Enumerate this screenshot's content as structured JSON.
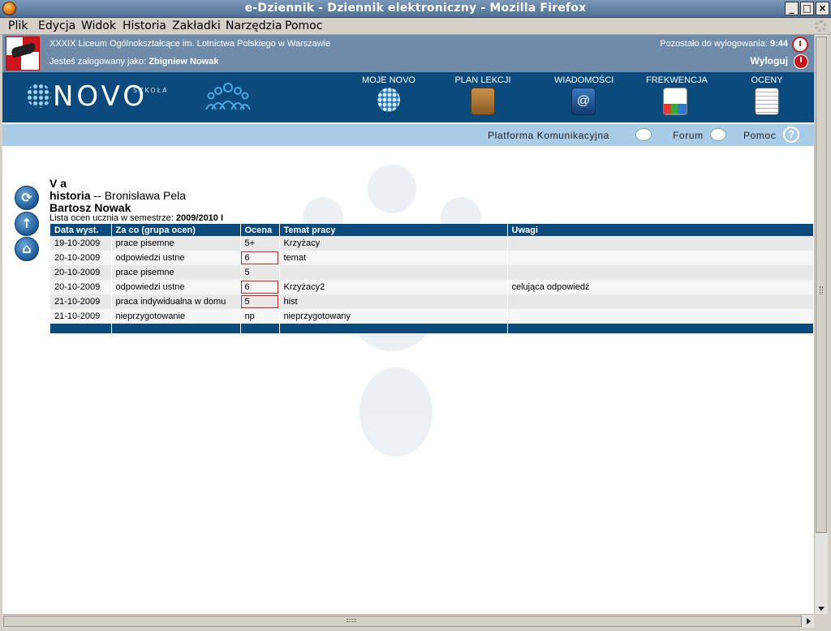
{
  "window": {
    "title": "e-Dziennik - Dziennik elektroniczny - Mozilla Firefox",
    "buttons": {
      "minimize": "_",
      "maximize": "□",
      "close": "×"
    }
  },
  "menubar": {
    "items": [
      "Plik",
      "Edycja",
      "Widok",
      "Historia",
      "Zakładki",
      "Narzędzia",
      "Pomoc"
    ]
  },
  "header": {
    "school_name": "XXXIX Liceum Ogólnokształcące im. Lotnictwa Polskiego w Warszawie",
    "logged_in_prefix": "Jesteś zalogowany jako:",
    "logged_in_user": "Zbigniew Nowak",
    "session_prefix": "Pozostało do wylogowania:",
    "session_time": "9:44",
    "logout_label": "Wyloguj"
  },
  "nav": {
    "logo_text": "NOVO",
    "logo_sub": "SZKOŁA",
    "items": [
      {
        "label": "MOJE NOVO",
        "icon": "globe-icon"
      },
      {
        "label": "PLAN LEKCJI",
        "icon": "planner-icon"
      },
      {
        "label": "WIADOMOŚCI",
        "icon": "mail-book-icon"
      },
      {
        "label": "FREKWENCJA",
        "icon": "chart-icon"
      },
      {
        "label": "OCENY",
        "icon": "gradebook-icon"
      }
    ]
  },
  "subnav": {
    "platform": "Platforma Komunikacyjna",
    "forum": "Forum",
    "help": "Pomoc",
    "help_glyph": "?"
  },
  "content": {
    "class_name": "V a",
    "subject": "historia",
    "subject_sep": "--",
    "teacher": "Bronisława Pela",
    "student": "Bartosz Nowak",
    "list_prefix": "Lista ocen ucznia w semestrze:",
    "semester": "2009/2010 I"
  },
  "grades": {
    "headers": [
      "Data wyst.",
      "Za co (grupa ocen)",
      "Ocena",
      "Temat pracy",
      "Uwagi"
    ],
    "rows": [
      {
        "date": "19-10-2009",
        "category": "prace pisemne",
        "grade": "5+",
        "topic": "Krzyżacy",
        "notes": "",
        "highlight": false
      },
      {
        "date": "20-10-2009",
        "category": "odpowiedzi ustne",
        "grade": "6",
        "topic": "temat",
        "notes": "",
        "highlight": true
      },
      {
        "date": "20-10-2009",
        "category": "prace pisemne",
        "grade": "5",
        "topic": "",
        "notes": "",
        "highlight": false
      },
      {
        "date": "20-10-2009",
        "category": "odpowiedzi ustne",
        "grade": "6",
        "topic": "Krzyżacy2",
        "notes": "celująca odpowiedź",
        "highlight": true
      },
      {
        "date": "21-10-2009",
        "category": "praca indywidualna w domu",
        "grade": "5",
        "topic": "hist",
        "notes": "",
        "highlight": true
      },
      {
        "date": "21-10-2009",
        "category": "nieprzygotowanie",
        "grade": "np",
        "topic": "nieprzygotowany",
        "notes": "",
        "highlight": false
      }
    ]
  },
  "colors": {
    "nav_band": "#0a4a7c",
    "top_band": "#6e8ca9",
    "sub_band": "#a9cce6",
    "highlight_border": "#cc2222"
  }
}
